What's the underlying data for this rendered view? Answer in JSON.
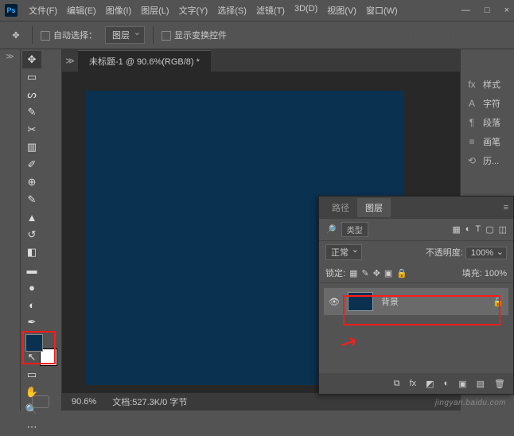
{
  "app": {
    "logo": "Ps"
  },
  "menu": [
    "文件(F)",
    "编辑(E)",
    "图像(I)",
    "图层(L)",
    "文字(Y)",
    "选择(S)",
    "滤镜(T)",
    "3D(D)",
    "视图(V)",
    "窗口(W)"
  ],
  "window_buttons": {
    "min": "—",
    "max": "□",
    "close": "×"
  },
  "options": {
    "auto_select": "自动选择：",
    "layer_dd": "图层",
    "show_transform": "显示变换控件"
  },
  "doc": {
    "tab": "未标题-1 @ 90.6%(RGB/8) *",
    "zoom": "90.6%",
    "status": "文档:527.3K/0 字节"
  },
  "right_panels": [
    {
      "icon": "fx",
      "label": "样式"
    },
    {
      "icon": "A",
      "label": "字符"
    },
    {
      "icon": "¶",
      "label": "段落"
    },
    {
      "icon": "≡",
      "label": "画笔"
    },
    {
      "icon": "⟲",
      "label": "历..."
    }
  ],
  "layers_panel": {
    "tabs": [
      "路径",
      "图层"
    ],
    "search": "类型",
    "blend": "正常",
    "opacity_lbl": "不透明度:",
    "opacity_val": "100%",
    "lock_lbl": "锁定:",
    "fill_lbl": "填充:",
    "fill_val": "100%",
    "layer_name": "背景"
  },
  "colors": {
    "canvas": "#0b3150"
  },
  "watermark": "jingyan.baidu.com"
}
